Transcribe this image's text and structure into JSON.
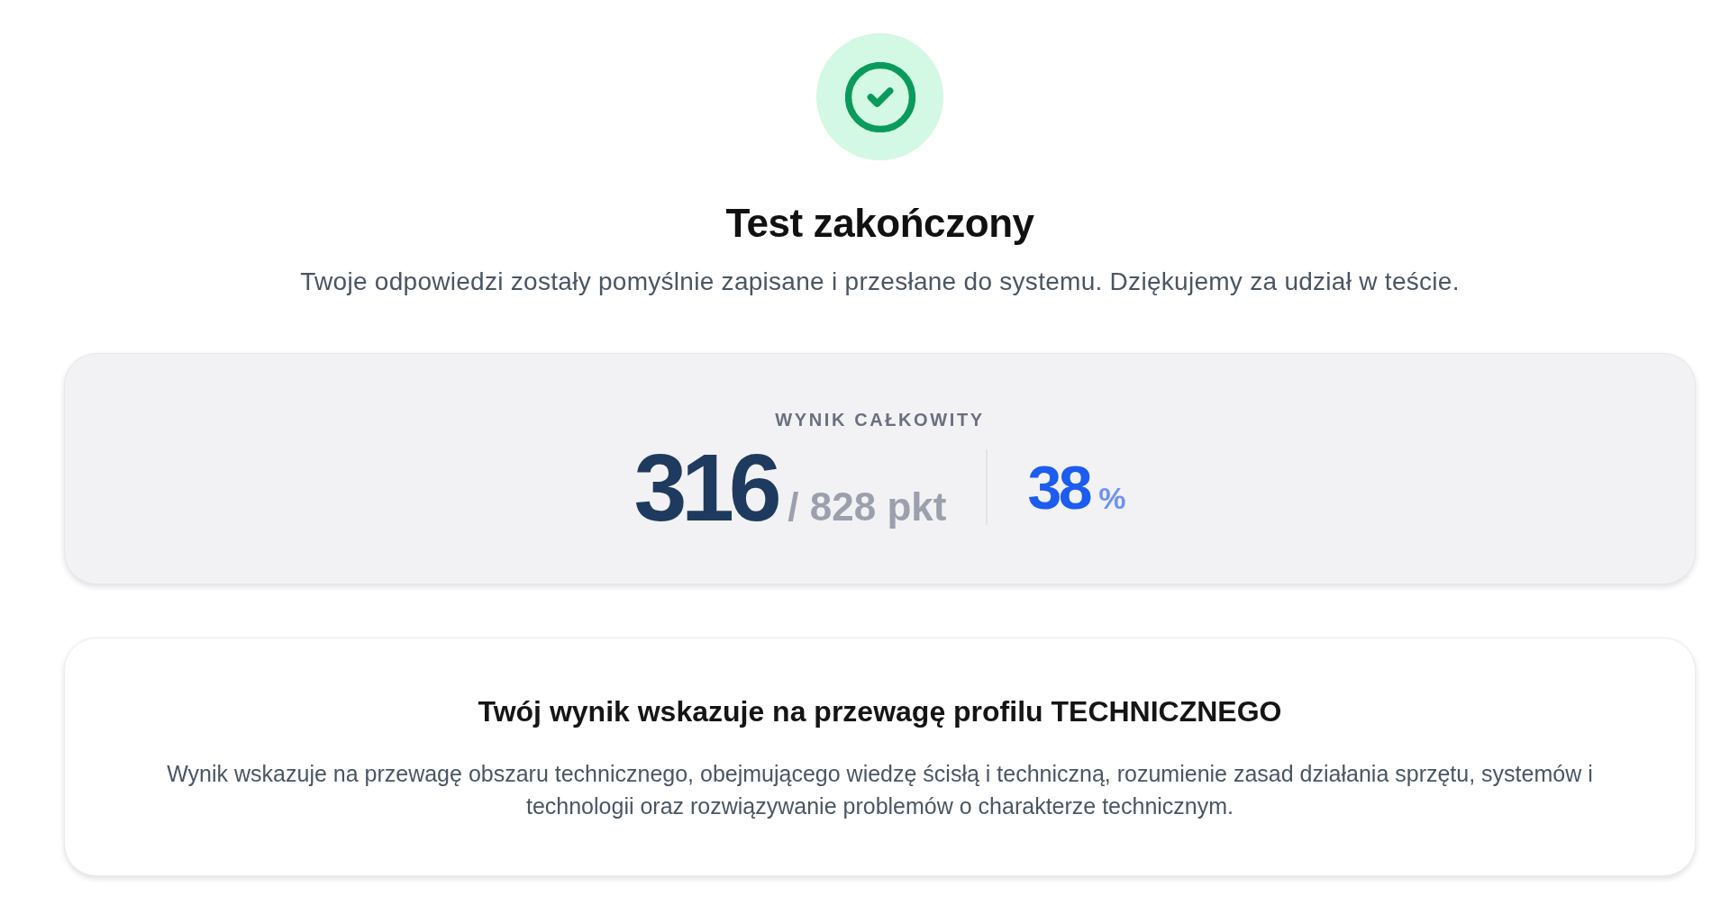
{
  "title": "Test zakończony",
  "message": "Twoje odpowiedzi zostały pomyślnie zapisane i przesłane do systemu. Dziękujemy za udział w teście.",
  "score_card": {
    "label": "WYNIK CAŁKOWITY",
    "score": "316",
    "max_score": "/ 828 pkt",
    "percent": "38",
    "percent_sign": "%"
  },
  "profile_card": {
    "heading": "Twój wynik wskazuje na przewagę profilu TECHNICZNEGO",
    "description": "Wynik wskazuje na przewagę obszaru technicznego, obejmującego wiedzę ścisłą i techniczną, rozumienie zasad działania sprzętu, systemów i technologii oraz rozwiązywanie problemów o charakterze technicznym."
  }
}
